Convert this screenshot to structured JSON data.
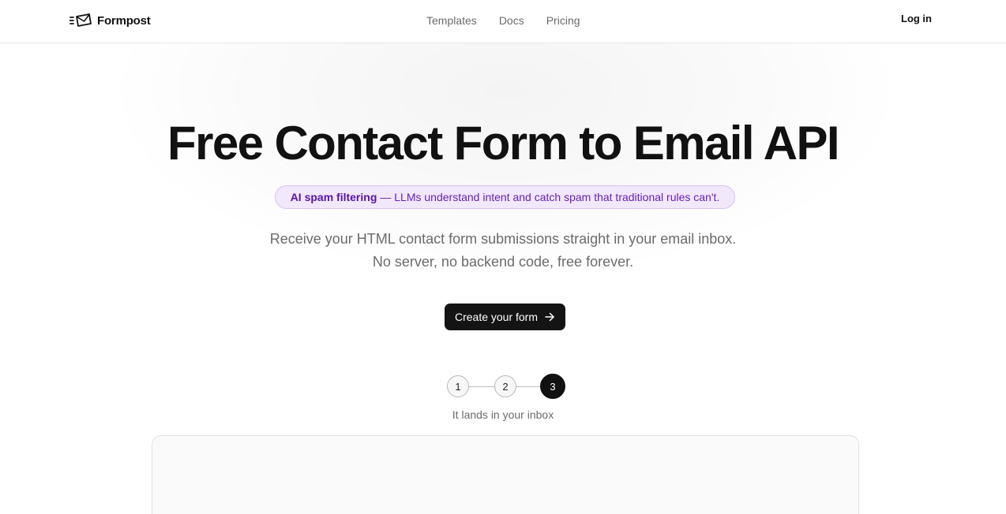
{
  "header": {
    "brand": {
      "name": "Formpost",
      "icon": "envelope-fast-icon"
    },
    "nav": [
      {
        "label": "Templates"
      },
      {
        "label": "Docs"
      },
      {
        "label": "Pricing"
      }
    ],
    "login_label": "Log in"
  },
  "hero": {
    "title": "Free Contact Form to Email API",
    "pill": {
      "strong": "AI spam filtering",
      "rest": "— LLMs understand intent and catch spam that traditional rules can't."
    },
    "subtitle_line1": "Receive your HTML contact form submissions straight in your email inbox.",
    "subtitle_line2": "No server, no backend code, free forever.",
    "cta_label": "Create your form",
    "cta_icon": "arrow-right-icon"
  },
  "steps": {
    "items": [
      {
        "number": "1",
        "active": false
      },
      {
        "number": "2",
        "active": false
      },
      {
        "number": "3",
        "active": true
      }
    ],
    "caption": "It lands in your inbox"
  },
  "colors": {
    "accent_purple": "#6a1fb8",
    "pill_bg": "#f1e8fb",
    "cta_bg": "#141414",
    "muted_text": "#6b6b6b"
  }
}
